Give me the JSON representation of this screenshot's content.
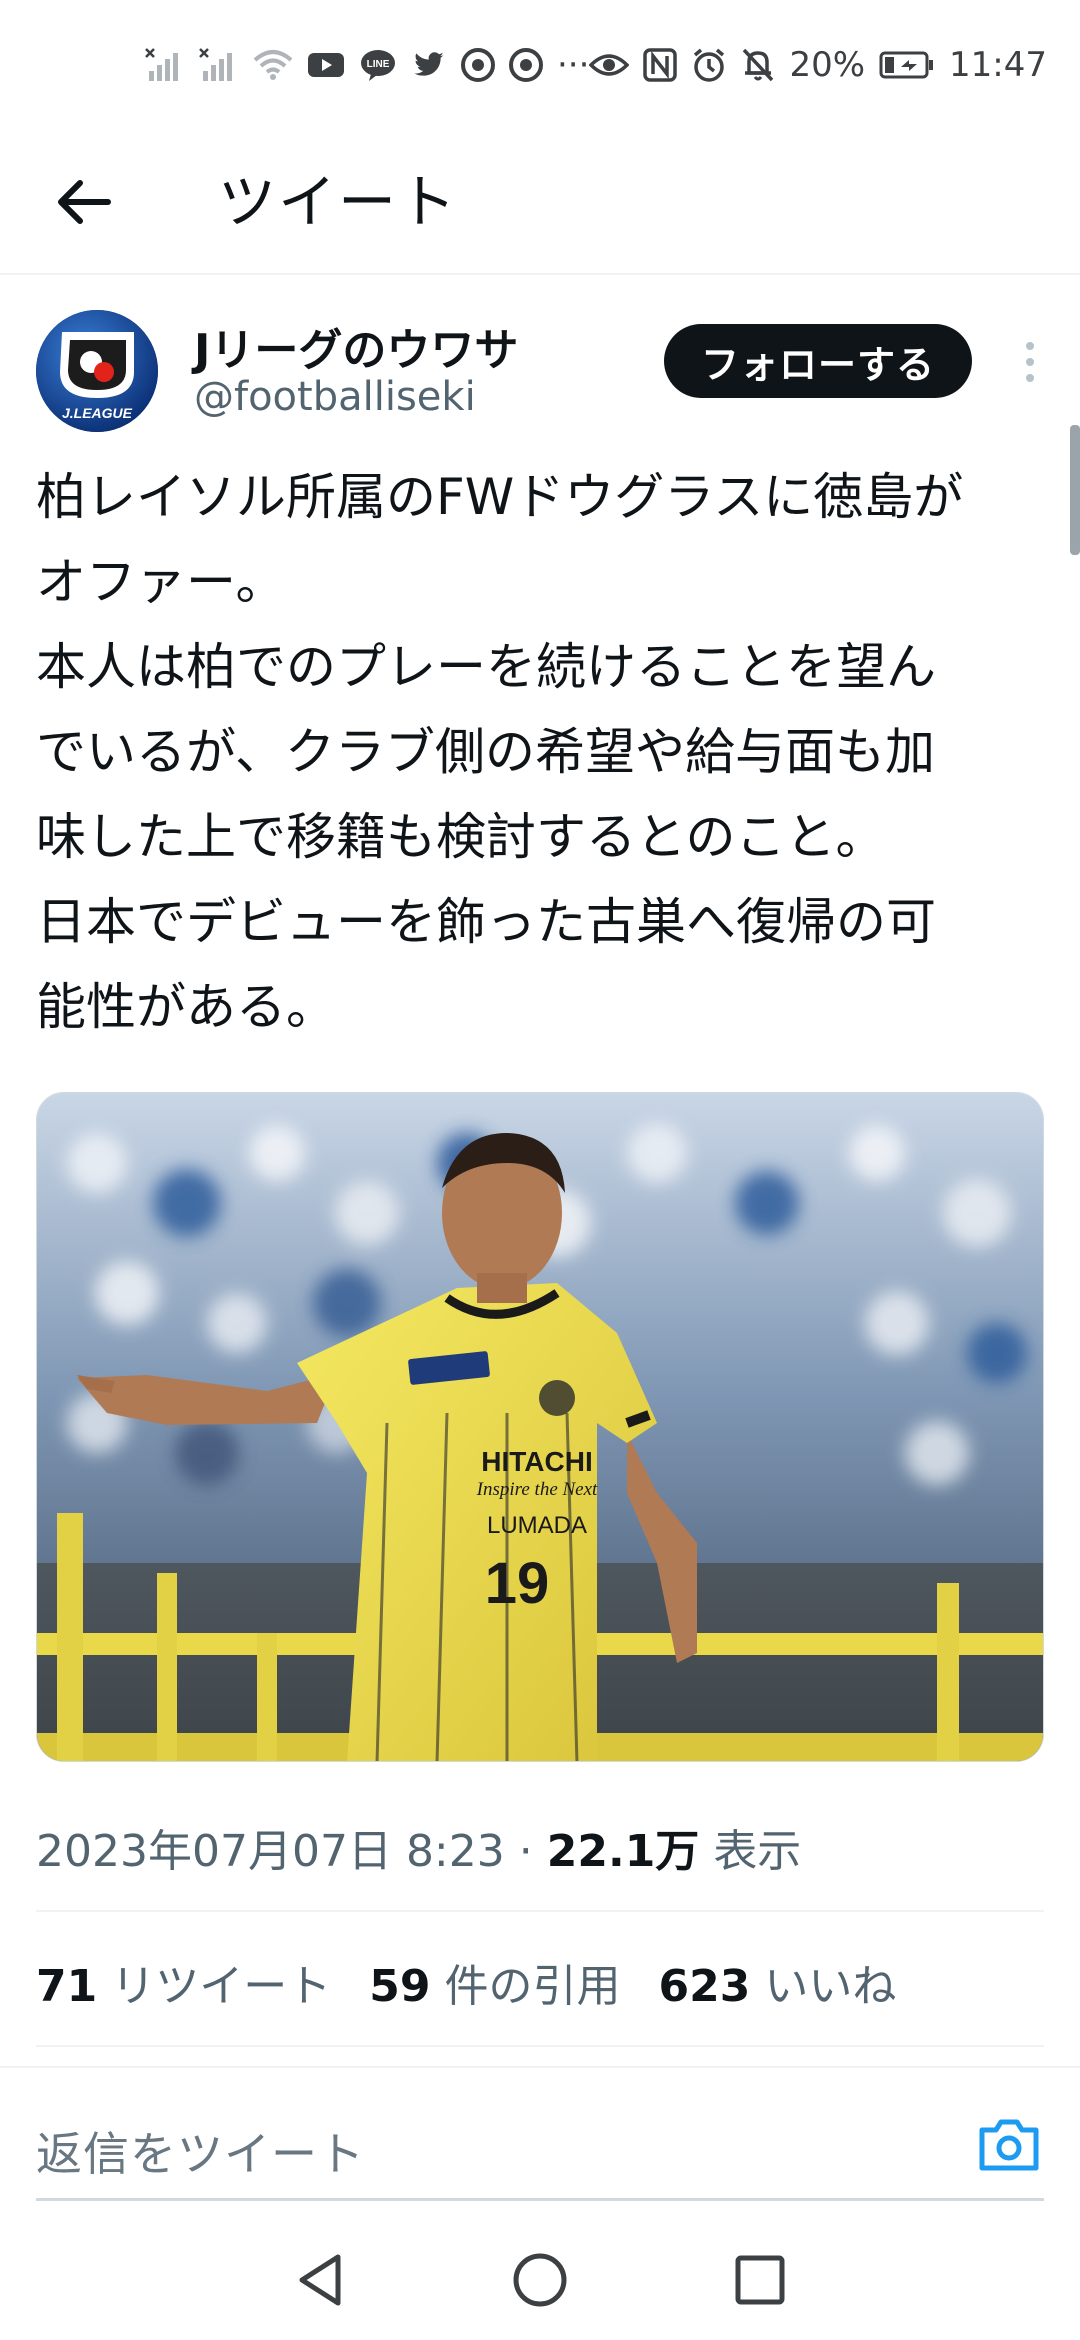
{
  "status_bar": {
    "battery": "20%",
    "time": "11:47",
    "left_icons": [
      "signal-off-icon",
      "signal-off-icon",
      "wifi-icon",
      "youtube-icon",
      "line-icon",
      "twitter-icon",
      "chrome-icon",
      "chrome-icon",
      "more-notifications-icon"
    ],
    "right_icons": [
      "eye-icon",
      "nfc-icon",
      "alarm-icon",
      "mute-icon",
      "battery-icon"
    ],
    "more": "···"
  },
  "header": {
    "title": "ツイート"
  },
  "author": {
    "name": "Jリーグのウワサ",
    "handle": "@footballiseki",
    "avatar_text": "J.LEAGUE",
    "follow_label": "フォローする"
  },
  "tweet": {
    "lines": [
      "柏レイソル所属のFWドウグラスに徳島が",
      "オファー。",
      "本人は柏でのプレーを続けることを望ん",
      "でいるが、クラブ側の希望や給与面も加",
      "味した上で移籍も検討するとのこと。",
      "日本でデビューを飾った古巣へ復帰の可",
      "能性がある。"
    ],
    "media": {
      "jersey_sponsor": "HITACHI",
      "jersey_tagline": "Inspire the Next",
      "jersey_sub": "LUMADA",
      "jersey_number": "19"
    }
  },
  "meta": {
    "timestamp": "2023年07月07日 8:23",
    "separator": "·",
    "views_count": "22.1万",
    "views_label": "表示"
  },
  "stats": {
    "retweets_count": "71",
    "retweets_label": "リツイート",
    "quotes_count": "59",
    "quotes_label": "件の引用",
    "likes_count": "623",
    "likes_label": "いいね"
  },
  "reply": {
    "placeholder": "返信をツイート"
  },
  "colors": {
    "text_primary": "#0f1419",
    "text_secondary": "#536471",
    "accent": "#1d9bf0",
    "jersey_yellow": "#f2e24a"
  }
}
